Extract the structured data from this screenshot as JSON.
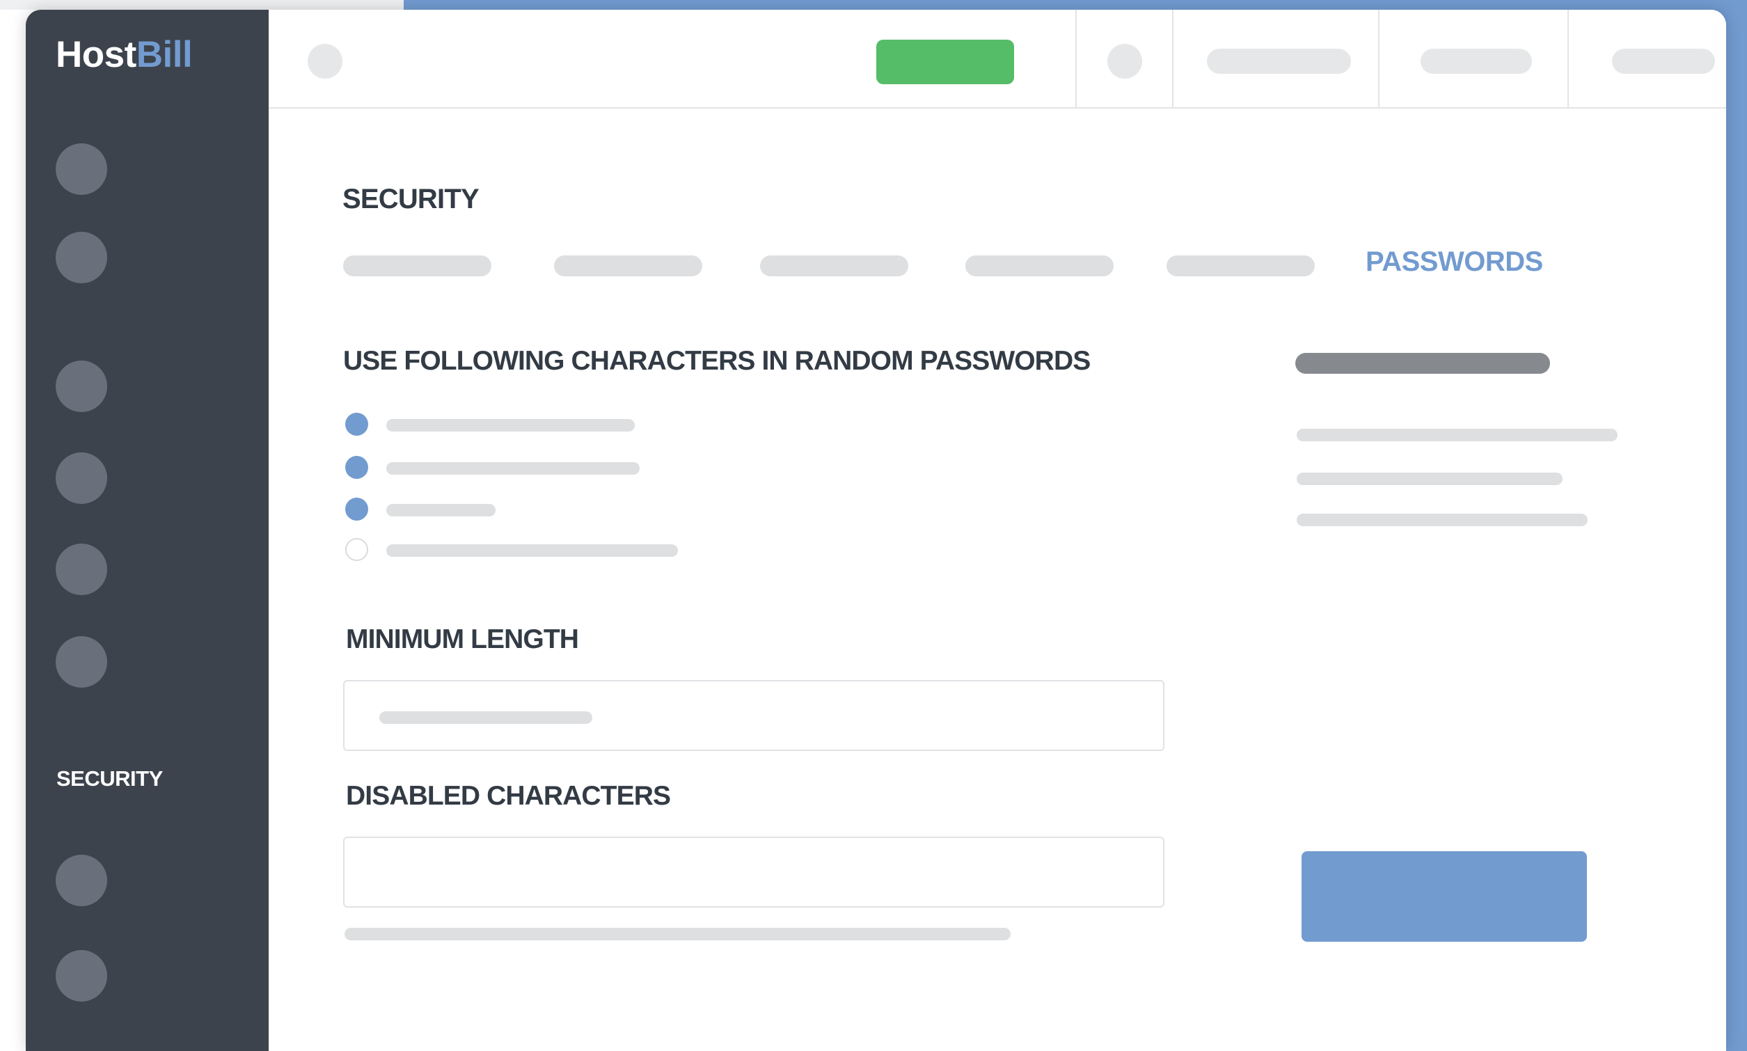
{
  "app": {
    "logo_host": "Host",
    "logo_bill": "Bill"
  },
  "sidebar": {
    "active_label": "SECURITY"
  },
  "main": {
    "page_title": "SECURITY",
    "active_tab": "PASSWORDS",
    "section_heading": "USE FOLLOWING CHARACTERS IN RANDOM PASSWORDS",
    "options": [
      {
        "checked": true
      },
      {
        "checked": true
      },
      {
        "checked": true
      },
      {
        "checked": false
      }
    ],
    "minimum_length_label": "MINIMUM LENGTH",
    "disabled_characters_label": "DISABLED CHARACTERS"
  },
  "colors": {
    "sidebar_bg": "#3d434d",
    "accent": "#729bd0",
    "green": "#55bc68",
    "text": "#333b45"
  },
  "icons": [
    "user-avatar-icon",
    "nav-icon"
  ]
}
